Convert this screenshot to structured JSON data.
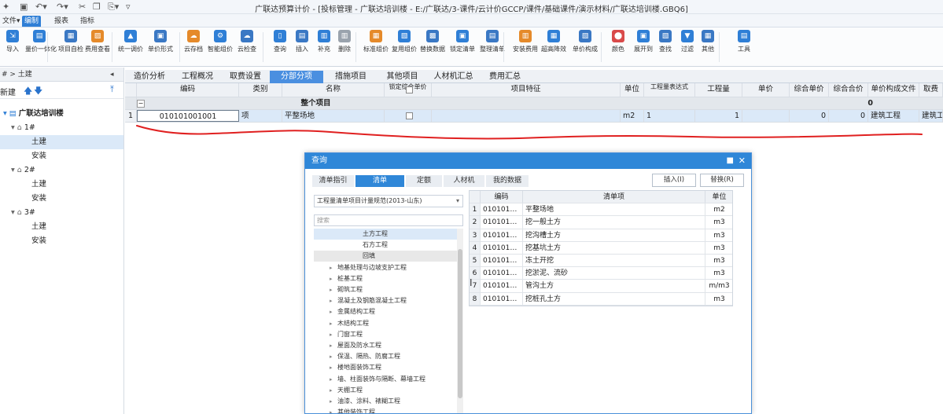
{
  "window": {
    "title": "广联达预算计价 - [投标管理 - 广联达培训楼 - E:/广联达/3-课件/云计价GCCP/课件/基础课件/演示材料/广联达培训楼.GBQ6]",
    "file_menu": "文件▾"
  },
  "ribbon_tabs": [
    "编制",
    "报表",
    "指标"
  ],
  "ribbon_buttons": [
    {
      "label": "导入",
      "icon": "import-icon"
    },
    {
      "label": "量价一体化",
      "icon": "quantity-price-icon"
    },
    {
      "label": "项目自检",
      "icon": "self-check-icon"
    },
    {
      "label": "费用查看",
      "icon": "fee-view-icon"
    },
    {
      "label": "统一调价",
      "icon": "price-adjust-icon"
    },
    {
      "label": "单价形式",
      "icon": "unit-price-icon"
    },
    {
      "label": "云存档",
      "icon": "cloud-save-icon"
    },
    {
      "label": "智能组价",
      "icon": "smart-pricing-icon"
    },
    {
      "label": "云检查",
      "icon": "cloud-check-icon"
    },
    {
      "label": "查询",
      "icon": "query-icon"
    },
    {
      "label": "插入",
      "icon": "insert-icon"
    },
    {
      "label": "补充",
      "icon": "supplement-icon"
    },
    {
      "label": "删除",
      "icon": "delete-icon"
    },
    {
      "label": "标准组价",
      "icon": "standard-pricing-icon"
    },
    {
      "label": "复用组价",
      "icon": "reuse-pricing-icon"
    },
    {
      "label": "替换数据",
      "icon": "replace-data-icon"
    },
    {
      "label": "锁定清单",
      "icon": "lock-list-icon"
    },
    {
      "label": "整理清单",
      "icon": "organize-list-icon"
    },
    {
      "label": "安装费用",
      "icon": "install-fee-icon"
    },
    {
      "label": "超高降效",
      "icon": "high-efficiency-icon"
    },
    {
      "label": "单价构成",
      "icon": "price-composition-icon"
    },
    {
      "label": "颜色",
      "icon": "color-icon"
    },
    {
      "label": "展开到",
      "icon": "expand-to-icon"
    },
    {
      "label": "查找",
      "icon": "find-icon"
    },
    {
      "label": "过滤",
      "icon": "filter-icon"
    },
    {
      "label": "其他",
      "icon": "other-icon"
    },
    {
      "label": "工具",
      "icon": "tools-icon"
    }
  ],
  "nav": {
    "header": "# > 土建",
    "new_label": "新建",
    "items": [
      {
        "label": "广联达培训楼",
        "level": 0
      },
      {
        "label": "1#",
        "level": 1
      },
      {
        "label": "土建",
        "level": 2
      },
      {
        "label": "安装",
        "level": 2
      },
      {
        "label": "2#",
        "level": 1
      },
      {
        "label": "土建",
        "level": 2
      },
      {
        "label": "安装",
        "level": 2
      },
      {
        "label": "3#",
        "level": 1
      },
      {
        "label": "土建",
        "level": 2
      },
      {
        "label": "安装",
        "level": 2
      }
    ]
  },
  "main_tabs": [
    "造价分析",
    "工程概况",
    "取费设置",
    "分部分项",
    "措施项目",
    "其他项目",
    "人材机汇总",
    "费用汇总"
  ],
  "grid": {
    "headers": [
      "",
      "编码",
      "类别",
      "名称",
      "锁定综合单价",
      "项目特征",
      "单位",
      "工程量表达式",
      "工程量",
      "单价",
      "综合单价",
      "综合合价",
      "单价构成文件",
      "取费"
    ],
    "group_row": {
      "toggle": "−",
      "name": "整个项目",
      "total": "0"
    },
    "rows": [
      {
        "idx": "1",
        "code": "010101001001",
        "type": "项",
        "name": "平整场地",
        "unit": "m2",
        "expr": "1",
        "qty": "1",
        "unit_price": "0",
        "total": "0",
        "comp_file": "建筑工程",
        "fee": "建筑工"
      }
    ]
  },
  "dialog": {
    "title": "查询",
    "tabs": [
      "清单指引",
      "清单",
      "定额",
      "人材机",
      "我的数据"
    ],
    "insert_btn": "插入(I)",
    "replace_btn": "替换(R)",
    "library": "工程量清单项目计量规范(2013-山东)",
    "search_placeholder": "搜索",
    "tree": [
      {
        "label": "土方工程",
        "level": 1,
        "toggle": "",
        "selected": true
      },
      {
        "label": "石方工程",
        "level": 1,
        "toggle": ""
      },
      {
        "label": "回填",
        "level": 1,
        "toggle": "",
        "shaded": true
      },
      {
        "label": "地基处理与边坡支护工程",
        "level": 0,
        "toggle": "▸"
      },
      {
        "label": "桩基工程",
        "level": 0,
        "toggle": "▸"
      },
      {
        "label": "砌筑工程",
        "level": 0,
        "toggle": "▸"
      },
      {
        "label": "混凝土及钢筋混凝土工程",
        "level": 0,
        "toggle": "▸"
      },
      {
        "label": "金属结构工程",
        "level": 0,
        "toggle": "▸"
      },
      {
        "label": "木结构工程",
        "level": 0,
        "toggle": "▸"
      },
      {
        "label": "门窗工程",
        "level": 0,
        "toggle": "▸"
      },
      {
        "label": "屋面及防水工程",
        "level": 0,
        "toggle": "▸"
      },
      {
        "label": "保温、隔热、防腐工程",
        "level": 0,
        "toggle": "▸"
      },
      {
        "label": "楼地面装饰工程",
        "level": 0,
        "toggle": "▸"
      },
      {
        "label": "墙、柱面装饰与隔断、幕墙工程",
        "level": 0,
        "toggle": "▸"
      },
      {
        "label": "天棚工程",
        "level": 0,
        "toggle": "▸"
      },
      {
        "label": "油漆、涂料、裱糊工程",
        "level": 0,
        "toggle": "▸"
      },
      {
        "label": "其他装饰工程",
        "level": 0,
        "toggle": "▸"
      }
    ],
    "list_headers": [
      "",
      "编码",
      "清单项",
      "单位"
    ],
    "list": [
      {
        "idx": "1",
        "code": "010101…",
        "name": "平整场地",
        "unit": "m2"
      },
      {
        "idx": "2",
        "code": "010101…",
        "name": "挖一般土方",
        "unit": "m3"
      },
      {
        "idx": "3",
        "code": "010101…",
        "name": "挖沟槽土方",
        "unit": "m3"
      },
      {
        "idx": "4",
        "code": "010101…",
        "name": "挖基坑土方",
        "unit": "m3"
      },
      {
        "idx": "5",
        "code": "010101…",
        "name": "冻土开挖",
        "unit": "m3"
      },
      {
        "idx": "6",
        "code": "010101…",
        "name": "挖淤泥、流砂",
        "unit": "m3"
      },
      {
        "idx": "7",
        "code": "010101…",
        "name": "管沟土方",
        "unit": "m/m3"
      },
      {
        "idx": "8",
        "code": "010101…",
        "name": "挖桩孔土方",
        "unit": "m3"
      }
    ]
  },
  "colors": {
    "accent": "#2f87d8",
    "annotation_red": "#e02020",
    "grid_header": "#eef1f5",
    "selected_row": "#dbe9f8"
  }
}
